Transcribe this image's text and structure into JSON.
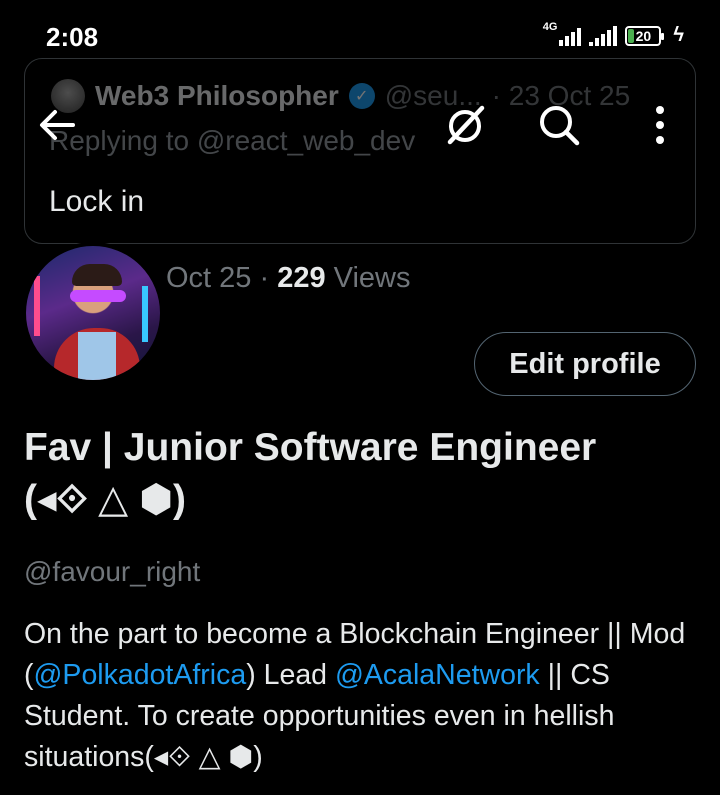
{
  "status_bar": {
    "time": "2:08",
    "network": "4G",
    "battery": "20"
  },
  "quoted_tweet": {
    "author": "Web3 Philosopher",
    "handle": "@seu...",
    "date": "· 23 Oct 25",
    "replying_to": "Replying to @react_web_dev",
    "text": "Lock in"
  },
  "meta": {
    "date": "Oct 25 · ",
    "views_count": "229",
    "views_label": " Views"
  },
  "profile": {
    "edit_label": "Edit profile",
    "name_line1": "Fav | Junior Software Engineer",
    "name_line2": "(◂⟐ △ ⬢)",
    "handle": "@favour_right",
    "bio_part1": "On the part to become a Blockchain Engineer || Mod (",
    "bio_link1": "@PolkadotAfrica",
    "bio_part2": ") Lead ",
    "bio_link2": "@AcalaNetwork",
    "bio_part3": " || CS Student.  To create opportunities even in hellish situations(◂⟐ △ ⬢)"
  },
  "icons": {
    "back": "back-arrow-icon",
    "grok": "grok-icon",
    "search": "search-icon",
    "more": "more-vertical-icon",
    "verified": "verified-badge-icon"
  },
  "colors": {
    "background": "#000000",
    "link": "#1d9bf0",
    "muted": "#71767b",
    "battery_fill": "#4caf50"
  }
}
